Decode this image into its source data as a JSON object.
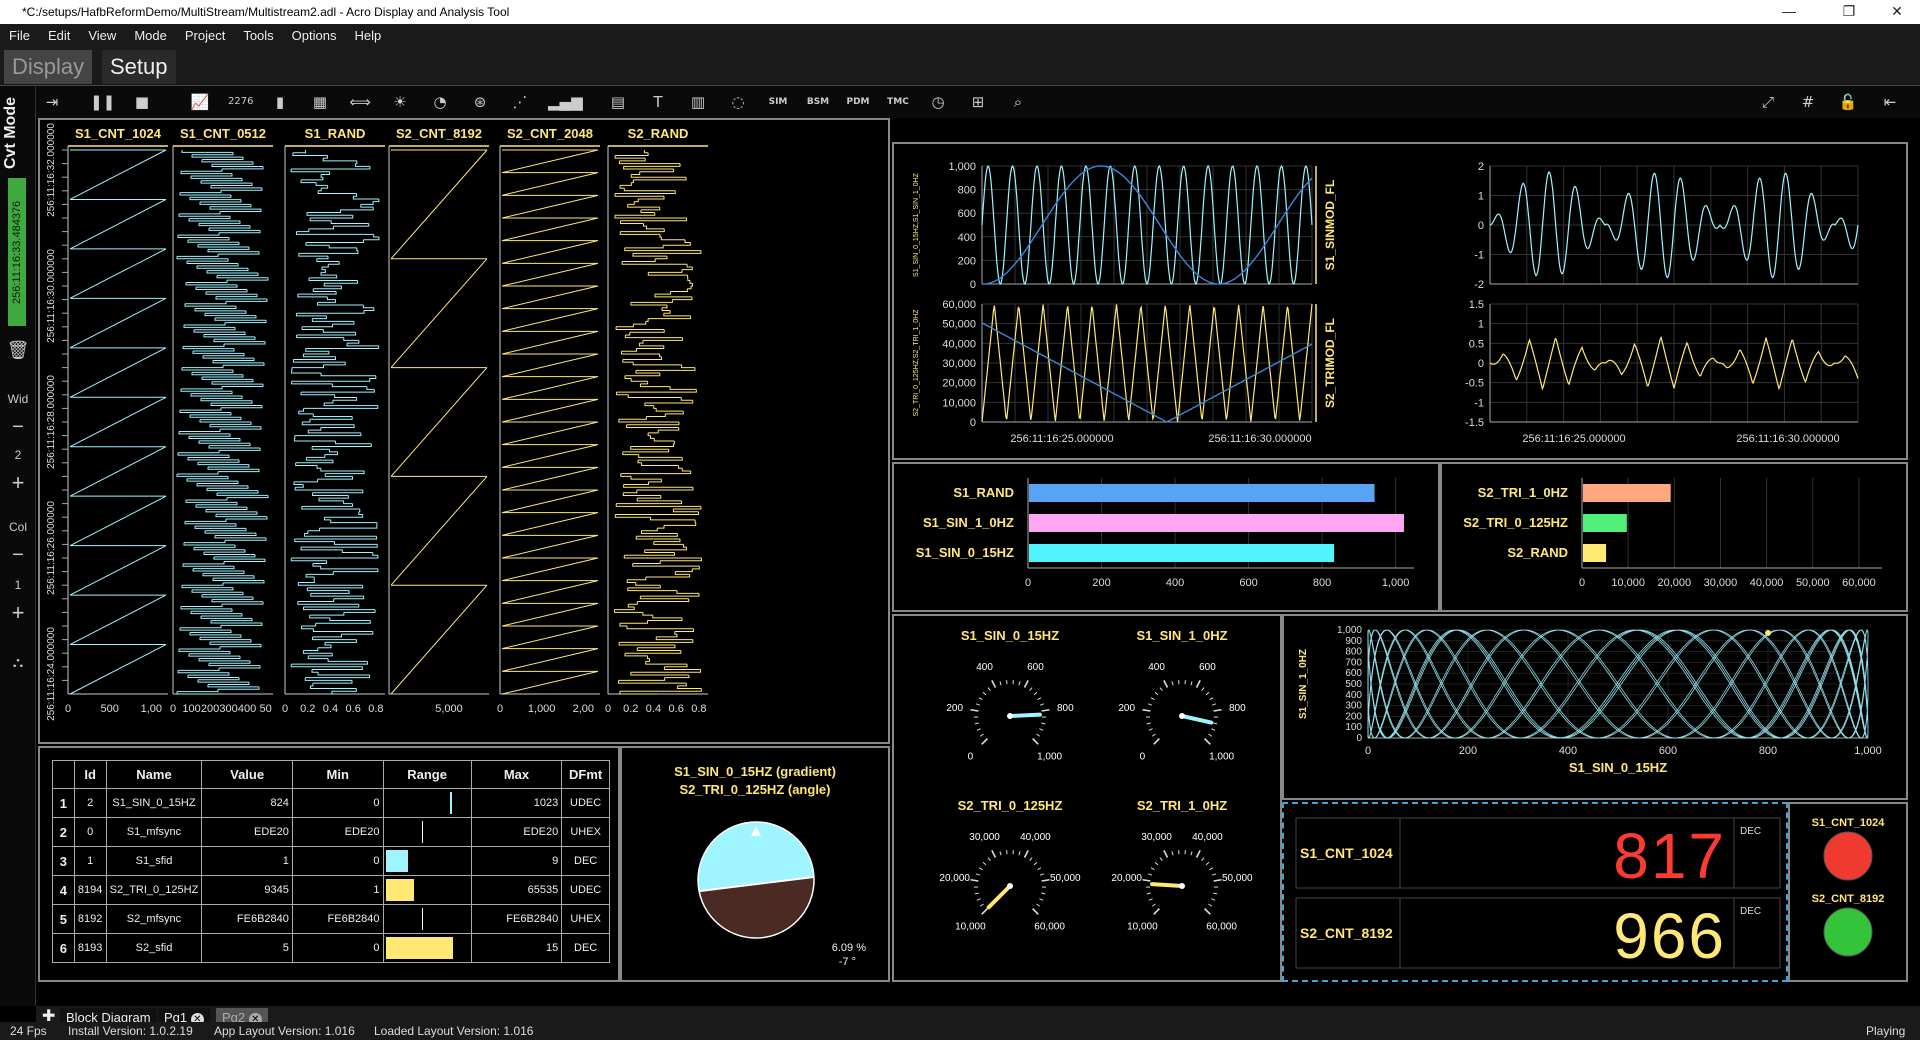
{
  "window": {
    "title": "*C:/setups/HafbReformDemo/MultiStream/Multistream2.adl - Acro Display and Analysis Tool",
    "minimize": "—",
    "maximize": "❐",
    "close": "✕"
  },
  "menu": [
    "File",
    "Edit",
    "View",
    "Mode",
    "Project",
    "Tools",
    "Options",
    "Help"
  ],
  "mode_tabs": {
    "display": "Display",
    "setup": "Setup"
  },
  "leftbar": {
    "mode": "Cvt Mode",
    "time": "256:11:16:33.484376",
    "wid_label": "Wid",
    "wid_value": "2",
    "col_label": "Col",
    "col_value": "1"
  },
  "toolbar_icons": [
    "dock-right-icon",
    "pause-icon",
    "stop-icon",
    "line-chart-icon",
    "numeric-display-icon",
    "bar-chart-icon",
    "table-icon",
    "link-icon",
    "alarm-icon",
    "gauge-icon",
    "dial-icon",
    "scatter-icon",
    "histogram-icon",
    "document-icon",
    "text-icon",
    "grid-icon",
    "clock-dial-icon",
    "sim-icon",
    "bsm-icon",
    "pdm-icon",
    "tmc-icon",
    "time-icon",
    "map-icon",
    "inspect-icon",
    "fullscreen-icon",
    "grid-lock-icon",
    "unlock-icon",
    "collapse-left-icon"
  ],
  "toolbar_labels": {
    "numeric": "2276",
    "sim": "SIM",
    "bsm": "BSM",
    "pdm": "PDM",
    "tmc": "TMC"
  },
  "strip_charts": {
    "time_labels": [
      "256:11:16:24.000000",
      "256:11:16:26.000000",
      "256:11:16:28.000000",
      "256:11:16:30.000000",
      "256:11:16:32.000000"
    ],
    "columns": [
      {
        "name": "S1_CNT_1024",
        "color": "#9ef4ff",
        "ticks": [
          "0",
          "500",
          "1,00"
        ]
      },
      {
        "name": "S1_CNT_0512",
        "color": "#9ef4ff",
        "ticks": [
          "0",
          "100",
          "200",
          "300",
          "400",
          "50"
        ]
      },
      {
        "name": "S1_RAND",
        "color": "#9ef4ff",
        "ticks": [
          "0",
          "0.2",
          "0.4",
          "0.6",
          "0.8"
        ]
      },
      {
        "name": "S2_CNT_8192",
        "color": "#ffe873",
        "ticks": [
          "5,000"
        ]
      },
      {
        "name": "S2_CNT_2048",
        "color": "#ffe873",
        "ticks": [
          "0",
          "1,000",
          "2,00"
        ]
      },
      {
        "name": "S2_RAND",
        "color": "#ffe873",
        "ticks": [
          "0",
          "0.2",
          "0.4",
          "0.6",
          "0.8"
        ]
      }
    ]
  },
  "table": {
    "headers": [
      "Id",
      "Name",
      "Value",
      "Min",
      "Range",
      "Max",
      "DFmt"
    ],
    "rows": [
      {
        "n": "1",
        "id": "2",
        "name": "S1_SIN_0_15HZ",
        "value": "824",
        "min": "0",
        "range": 0.805,
        "max": "1023",
        "fmt": "UDEC"
      },
      {
        "n": "2",
        "id": "0",
        "name": "S1_mfsync",
        "value": "EDE20",
        "min": "EDE20",
        "range": 0.0,
        "max": "EDE20",
        "fmt": "UHEX"
      },
      {
        "n": "3",
        "id": "1",
        "name": "S1_sfid",
        "value": "1",
        "min": "0",
        "range": 0.11,
        "max": "9",
        "fmt": "DEC"
      },
      {
        "n": "4",
        "id": "8194",
        "name": "S2_TRI_0_125HZ",
        "value": "9345",
        "min": "1",
        "range": 0.14,
        "max": "65535",
        "fmt": "UDEC"
      },
      {
        "n": "5",
        "id": "8192",
        "name": "S2_mfsync",
        "value": "FE6B2840",
        "min": "FE6B2840",
        "range": 0.0,
        "max": "FE6B2840",
        "fmt": "UHEX"
      },
      {
        "n": "6",
        "id": "8193",
        "name": "S2_sfid",
        "value": "5",
        "min": "0",
        "range": 0.33,
        "max": "15",
        "fmt": "DEC"
      }
    ]
  },
  "attitude": {
    "title1": "S1_SIN_0_15HZ (gradient)",
    "title2": "S2_TRI_0_125HZ (angle)",
    "pct": "6.09 %",
    "angle": "-7 °"
  },
  "line_charts": {
    "left_top": {
      "ylabel": "S1_SIN_0_15HZ,S1_SIN_1_0HZ",
      "right_label": "S1_SINMOD_FL",
      "yticks": [
        "1,000",
        "800",
        "600",
        "400",
        "200",
        "0"
      ]
    },
    "left_bottom": {
      "ylabel": "S2_TRI_0_125HZ,S2_TRI_1_0HZ",
      "right_label": "S2_TRIMOD_FL",
      "yticks": [
        "60,000",
        "50,000",
        "40,000",
        "30,000",
        "20,000",
        "10,000",
        "0"
      ]
    },
    "right_top": {
      "yticks": [
        "2",
        "1",
        "0",
        "-1",
        "-2"
      ]
    },
    "right_bottom": {
      "yticks": [
        "1.5",
        "1",
        "0.5",
        "0",
        "-0.5",
        "-1",
        "-1.5"
      ]
    },
    "xticks": [
      "256:11:16:25.000000",
      "256:11:16:30.000000"
    ]
  },
  "chart_data": [
    {
      "type": "bar",
      "categories": [
        "S1_RAND",
        "S1_SIN_1_0HZ",
        "S1_SIN_0_15HZ"
      ],
      "values": [
        940,
        1020,
        830
      ],
      "xticks": [
        "0",
        "200",
        "400",
        "600",
        "800",
        "1,000"
      ],
      "xlim": [
        0,
        1050
      ],
      "colors": [
        "#59a3f5",
        "#ffa6f2",
        "#4ff4ff"
      ]
    },
    {
      "type": "bar",
      "categories": [
        "S2_TRI_1_0HZ",
        "S2_TRI_0_125HZ",
        "S2_RAND"
      ],
      "values": [
        19000,
        9500,
        5000
      ],
      "xticks": [
        "0",
        "10,000",
        "20,000",
        "30,000",
        "40,000",
        "50,000",
        "60,000"
      ],
      "xlim": [
        0,
        65000
      ],
      "colors": [
        "#ffa77f",
        "#4fef79",
        "#ffeb73"
      ]
    }
  ],
  "gauges": [
    {
      "name": "S1_SIN_0_15HZ",
      "ticks": [
        "0",
        "200",
        "400",
        "600",
        "800",
        "1,000"
      ],
      "value": 824,
      "max": 1000
    },
    {
      "name": "S1_SIN_1_0HZ",
      "ticks": [
        "0",
        "200",
        "400",
        "600",
        "800",
        "1,000"
      ],
      "value": 880,
      "max": 1000
    },
    {
      "name": "S2_TRI_0_125HZ",
      "ticks": [
        "10,000",
        "20,000",
        "30,000",
        "40,000",
        "50,000",
        "60,000"
      ],
      "value": 9345,
      "max": 60000
    },
    {
      "name": "S2_TRI_1_0HZ",
      "ticks": [
        "10,000",
        "20,000",
        "30,000",
        "40,000",
        "50,000",
        "60,000"
      ],
      "value": 19000,
      "max": 60000
    }
  ],
  "xy_plot": {
    "ylabel": "S1_SIN_1_0HZ",
    "xlabel": "S1_SIN_0_15HZ",
    "xticks": [
      "0",
      "200",
      "400",
      "600",
      "800",
      "1,000"
    ],
    "yticks": [
      "1,000",
      "900",
      "800",
      "700",
      "600",
      "500",
      "400",
      "300",
      "200",
      "100",
      "0"
    ]
  },
  "digital": [
    {
      "name": "S1_CNT_1024",
      "value": "817",
      "fmt": "DEC",
      "color": "#ff3b2f"
    },
    {
      "name": "S2_CNT_8192",
      "value": "966",
      "fmt": "DEC",
      "color": "#ffe873"
    }
  ],
  "leds": [
    {
      "name": "S1_CNT_1024",
      "color": "#ee3a2f"
    },
    {
      "name": "S2_CNT_8192",
      "color": "#33c43b"
    }
  ],
  "page_tabs": {
    "block": "Block Diagram",
    "pg1": "Pg1",
    "pg2": "Pg2"
  },
  "status": {
    "fps": "24 Fps",
    "install": "Install Version: 1.0.2.19",
    "app": "App Layout Version: 1.016",
    "loaded": "Loaded Layout Version: 1.016",
    "state": "Playing"
  }
}
